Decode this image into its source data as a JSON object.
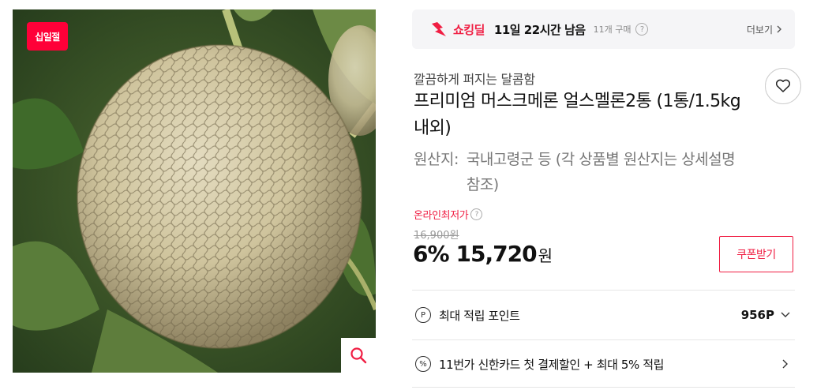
{
  "image": {
    "badge_label": "십일절",
    "zoom_icon": "search-icon"
  },
  "deal_bar": {
    "label": "쇼킹딜",
    "remaining": "11일 22시간 남음",
    "sold": "11개 구매",
    "help": "?",
    "more_label": "더보기",
    "more_icon": "chevron-right-icon"
  },
  "product": {
    "subtitle": "깔끔하게 퍼지는 달콤함",
    "title": "프리미엄 머스크메론 얼스멜론2통 (1통/1.5kg내외)",
    "origin_label": "원산지:",
    "origin_value": "국내고령군 등 (각 상품별 원산지는 상세설명 참조)",
    "wish_icon": "heart-icon"
  },
  "price": {
    "lowest_label": "온라인최저가",
    "help": "?",
    "original": "16,900원",
    "discount": "6%",
    "sale": "15,720",
    "currency": "원",
    "coupon_label": "쿠폰받기"
  },
  "benefits": [
    {
      "icon_text": "P",
      "text": "최대 적립 포인트",
      "value": "956P",
      "chevron": "chevron-down-icon"
    },
    {
      "icon_text": "%",
      "text": "11번가 신한카드 첫 결제할인 + 최대 5% 적립",
      "value": "",
      "chevron": "chevron-right-icon"
    }
  ],
  "colors": {
    "accent": "#f01e43",
    "badge": "#ff0038",
    "deal_bar_bg": "#f5f5f7"
  }
}
